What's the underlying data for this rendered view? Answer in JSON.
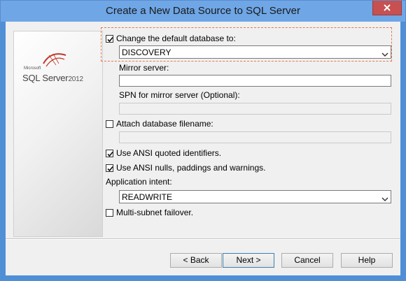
{
  "window": {
    "title": "Create a New Data Source to SQL Server"
  },
  "logo": {
    "microsoft": "Microsoft",
    "product": "SQL Server",
    "version": "2012"
  },
  "form": {
    "change_default_db": {
      "label": "Change the default database to:",
      "checked": true
    },
    "database": {
      "value": "DISCOVERY"
    },
    "mirror_server": {
      "label": "Mirror server:",
      "value": ""
    },
    "spn_mirror": {
      "label": "SPN for mirror server (Optional):",
      "value": ""
    },
    "attach_db_filename": {
      "label": "Attach database filename:",
      "checked": false,
      "value": ""
    },
    "ansi_quoted": {
      "label": "Use ANSI quoted identifiers.",
      "checked": true
    },
    "ansi_nulls": {
      "label": "Use ANSI nulls, paddings and warnings.",
      "checked": true
    },
    "application_intent": {
      "label": "Application intent:",
      "value": "READWRITE"
    },
    "multi_subnet": {
      "label": "Multi-subnet failover.",
      "checked": false
    }
  },
  "buttons": {
    "back": "< Back",
    "next": "Next >",
    "cancel": "Cancel",
    "help": "Help"
  },
  "colors": {
    "titlebar": "#6ea6e6",
    "close": "#c75050",
    "focus_border": "#e07a4a"
  }
}
